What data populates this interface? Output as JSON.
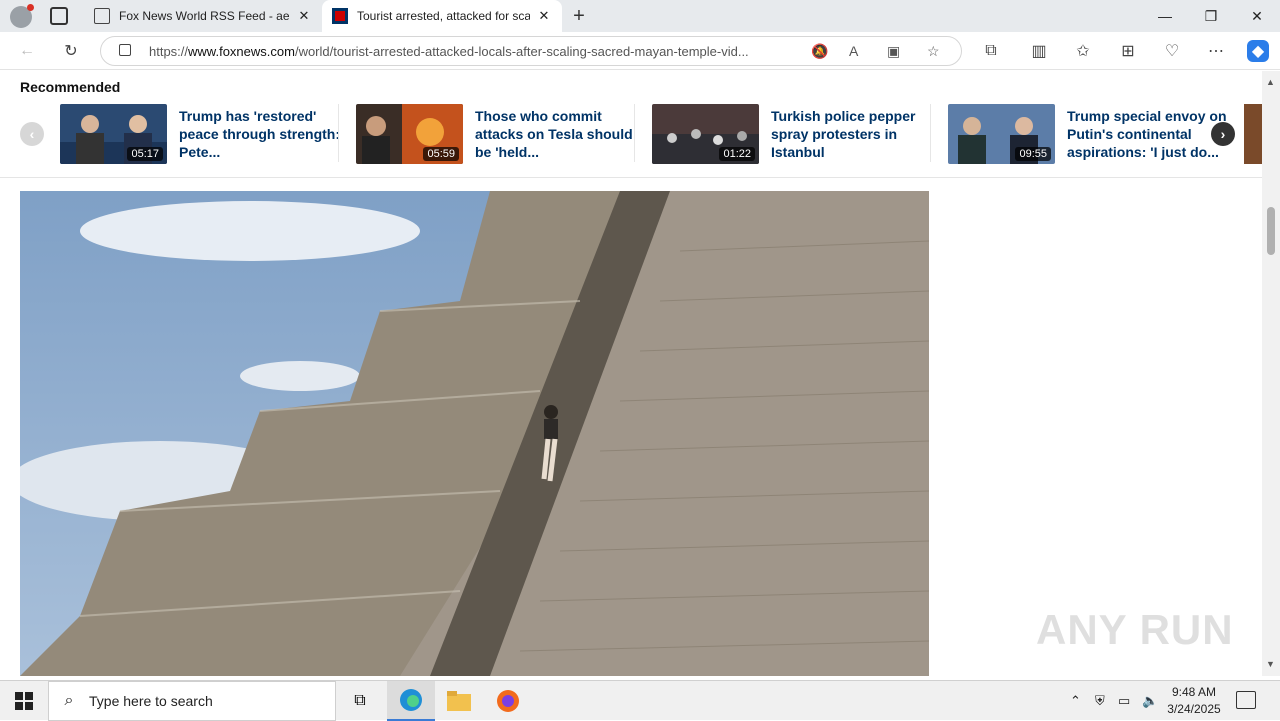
{
  "browser": {
    "tabs": [
      {
        "title": "Fox News World RSS Feed - aero",
        "icon": "document-icon"
      },
      {
        "title": "Tourist arrested, attacked for scal",
        "icon": "foxnews-icon"
      }
    ],
    "new_tab": "+",
    "window_controls": {
      "minimize": "—",
      "restore": "❐",
      "close": "✕"
    },
    "address": {
      "prefix": "https://",
      "domain": "www.foxnews.com",
      "path": "/world/tourist-arrested-attacked-locals-after-scaling-sacred-mayan-temple-vid..."
    }
  },
  "page": {
    "recommended_title": "Recommended",
    "items": [
      {
        "headline": "Trump has 'restored' peace through strength: Pete...",
        "duration": "05:17"
      },
      {
        "headline": "Those who commit attacks on Tesla should be 'held...",
        "duration": "05:59"
      },
      {
        "headline": "Turkish police pepper spray protesters in Istanbul",
        "duration": "01:22"
      },
      {
        "headline": "Trump special envoy on Putin's continental aspirations: 'I just do...",
        "duration": "09:55"
      }
    ],
    "prev_arrow": "‹",
    "next_arrow": "›"
  },
  "watermark": "ANY RUN",
  "taskbar": {
    "search_placeholder": "Type here to search",
    "time": "9:48 AM",
    "date": "3/24/2025"
  },
  "colors": {
    "headline": "#003366",
    "tabbar": "#e7eaed",
    "taskbar": "#f0f0f0"
  }
}
